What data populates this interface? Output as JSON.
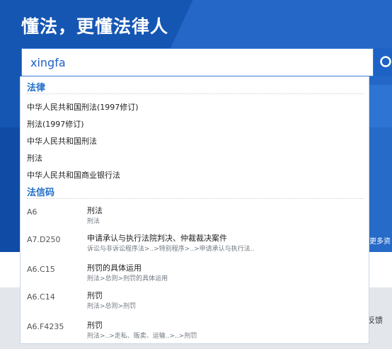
{
  "hero": {
    "slogan": "懂法，更懂法律人",
    "more": "更多资"
  },
  "search": {
    "value": "xingfa",
    "button_icon": "search-icon"
  },
  "footer": {
    "feedback": "反馈"
  },
  "dropdown": {
    "laws_title": "法律",
    "laws": [
      "中华人民共和国刑法(1997修订)",
      "刑法(1997修订)",
      "中华人民共和国刑法",
      "刑法",
      "中华人民共和国商业银行法"
    ],
    "codes_title": "法信码",
    "codes": [
      {
        "code": "A6",
        "title": "刑法",
        "path": "刑法"
      },
      {
        "code": "A7.D250",
        "title": "申请承认与执行法院判决、仲裁裁决案件",
        "path": "诉讼与非诉讼程序法>..>特别程序>..>申请承认与执行法.."
      },
      {
        "code": "A6.C15",
        "title": "刑罚的具体运用",
        "path": "刑法>总则>刑罚的具体运用"
      },
      {
        "code": "A6.C14",
        "title": "刑罚",
        "path": "刑法>总则>刑罚"
      },
      {
        "code": "A6.F4235",
        "title": "刑罚",
        "path": "刑法>..>走私、贩卖、运输..>..>刑罚"
      }
    ]
  },
  "colors": {
    "brand_blue": "#1656b3",
    "accent_blue": "#1f6cc9"
  }
}
